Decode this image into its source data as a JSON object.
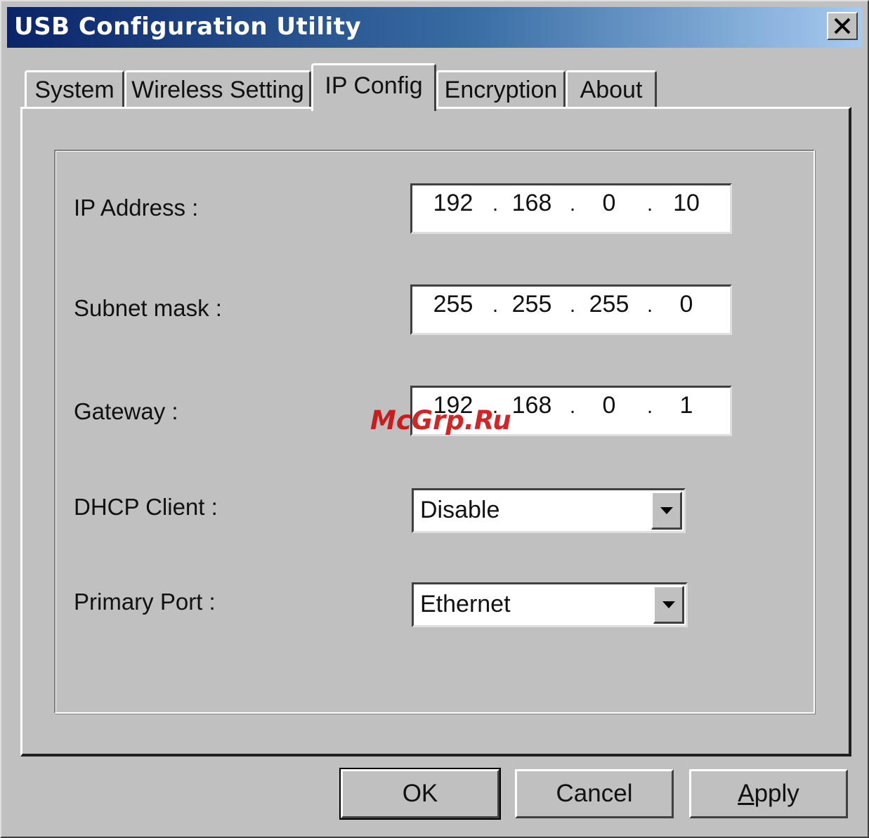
{
  "window": {
    "title": "USB Configuration Utility",
    "close_label": "close"
  },
  "tabs": [
    {
      "label": "System",
      "active": false
    },
    {
      "label": "Wireless Setting",
      "active": false
    },
    {
      "label": "IP Config",
      "active": true
    },
    {
      "label": "Encryption",
      "active": false
    },
    {
      "label": "About",
      "active": false
    }
  ],
  "fields": {
    "ip_address": {
      "label": "IP Address :",
      "octets": [
        "192",
        "168",
        "0",
        "10"
      ]
    },
    "subnet_mask": {
      "label": "Subnet mask :",
      "octets": [
        "255",
        "255",
        "255",
        "0"
      ]
    },
    "gateway": {
      "label": "Gateway :",
      "octets": [
        "192",
        "168",
        "0",
        "1"
      ]
    },
    "dhcp_client": {
      "label": "DHCP Client :",
      "value": "Disable"
    },
    "primary_port": {
      "label": "Primary Port :",
      "value": "Ethernet"
    }
  },
  "buttons": {
    "ok": "OK",
    "cancel": "Cancel",
    "apply_mnemonic": "A",
    "apply_rest": "pply"
  },
  "watermark": "McGrp.Ru",
  "icons": {
    "close": "close-icon",
    "dropdown": "chevron-down-icon"
  }
}
